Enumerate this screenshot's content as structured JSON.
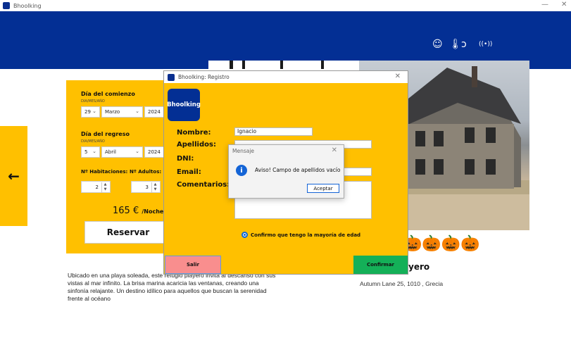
{
  "app": {
    "title": "Bhoolking",
    "min": "—",
    "close": "✕"
  },
  "header": {
    "icons": [
      "ghost-icon",
      "thermometer-icon",
      "ear-icon",
      "signal-icon"
    ],
    "glyphs": [
      "☺",
      "🌡",
      "ↄ",
      "((•))"
    ]
  },
  "nav": {
    "prev_glyph": "←"
  },
  "booking": {
    "start_label": "Día del comienzo",
    "start_sub": "DIA/MES/AÑO",
    "start_day": "29",
    "start_month": "Marzo",
    "start_year": "2024",
    "end_label": "Día del regreso",
    "end_sub": "DIA/MES/AÑO",
    "end_day": "5",
    "end_month": "Abril",
    "end_year": "2024",
    "rooms_label": "Nº Habitaciones:",
    "rooms_value": "2",
    "adults_label": "Nº Adultos:",
    "adults_value": "3",
    "price": "165 €",
    "price_unit": "/Noche",
    "reserve_label": "Reservar"
  },
  "listing": {
    "title_partial": "yero",
    "address": "Autumn Lane 25, 1010 , Grecia",
    "description": "Ubicado en una playa soleada, este refugio playero invita al descanso con sus vistas al mar infinito. La brisa marina acaricia las ventanas, creando una sinfonía relajante. Un destino idílico para aquellos que buscan la serenidad frente al océano",
    "pumpkins": "🎃🎃🎃🎃"
  },
  "dialog": {
    "title": "Bhoolking: Registro",
    "close": "✕",
    "brand": "Bhoolking",
    "nombre_label": "Nombre:",
    "nombre_value": "Ignacio",
    "apellidos_label": "Apellidos:",
    "apellidos_value": "",
    "dni_label": "DNI:",
    "dni_value": "",
    "email_label": "Email:",
    "email_value": "",
    "comentarios_label": "Comentarios:",
    "comentarios_value": "",
    "age_check": "Confirmo que tengo la mayoría de edad",
    "salir": "Salir",
    "confirmar": "Confirmar"
  },
  "message": {
    "title": "Mensaje",
    "close": "✕",
    "icon": "i",
    "text": "Aviso! Campo de apellidos vacío",
    "ok": "Aceptar"
  }
}
